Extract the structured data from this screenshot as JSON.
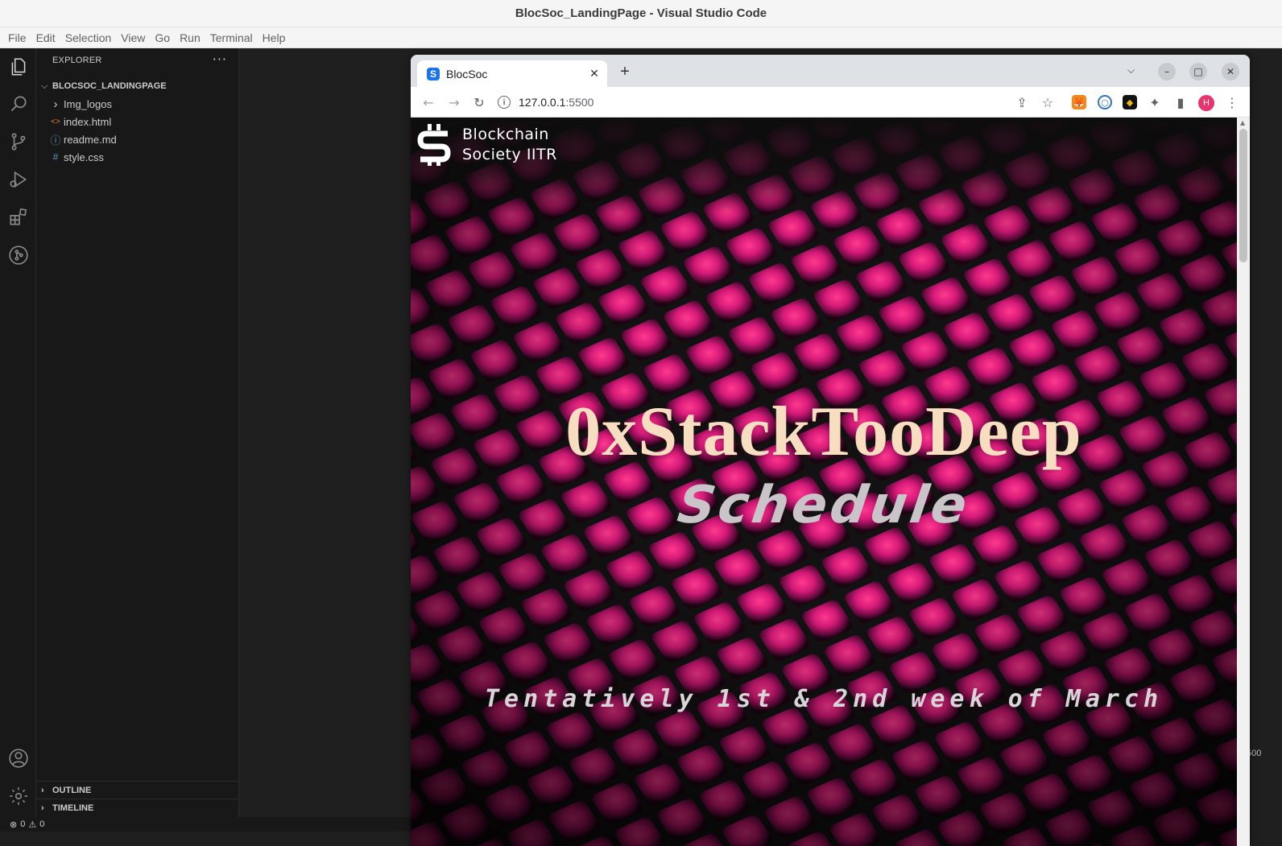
{
  "window": {
    "title": "BlocSoc_LandingPage - Visual Studio Code"
  },
  "menu": [
    "File",
    "Edit",
    "Selection",
    "View",
    "Go",
    "Run",
    "Terminal",
    "Help"
  ],
  "explorer": {
    "header": "EXPLORER",
    "more": "···",
    "root": "BLOCSOC_LANDINGPAGE",
    "items": [
      {
        "label": "Img_logos",
        "icon": "chevron-right-icon",
        "glyph": "›"
      },
      {
        "label": "index.html",
        "icon": "html-file-icon",
        "glyph": "<>"
      },
      {
        "label": "readme.md",
        "icon": "info-icon",
        "glyph": "ⓘ"
      },
      {
        "label": "style.css",
        "icon": "css-file-icon",
        "glyph": "#"
      }
    ],
    "outline": "OUTLINE",
    "timeline": "TIMELINE"
  },
  "status": {
    "errors": "0",
    "warnings": "0"
  },
  "port_hint": "500",
  "browser": {
    "tab_title": "BlocSoc",
    "tab_favicon": "S",
    "new_tab": "+",
    "url_host": "127.0.0.1",
    "url_port": ":5500",
    "profile_initial": "H"
  },
  "page": {
    "brand_line1": "Blockchain",
    "brand_line2": "Society IITR",
    "title": "0xStackTooDeep",
    "subtitle": "Schedule",
    "date": "Tentatively 1st & 2nd week of March"
  },
  "colors": {
    "accent_pink": "#f0287a",
    "title_cream": "#f7dec0",
    "profile_avatar": "#e8336d"
  }
}
